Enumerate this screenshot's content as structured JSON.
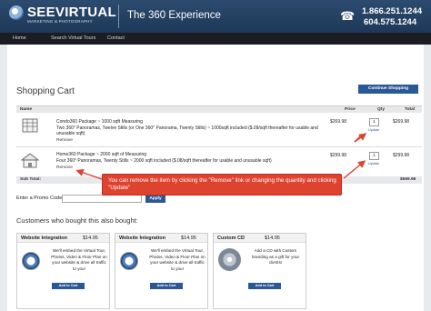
{
  "header": {
    "logo_text": "SEEVIRTUAL",
    "logo_sub": "MARKETING & PHOTOGRAPHY",
    "tagline": "The 360 Experience",
    "phone1": "1.866.251.1244",
    "phone2": "604.575.1244",
    "icons": [
      "globe-logo-icon",
      "phone-icon"
    ]
  },
  "nav": {
    "items": [
      "Home",
      "Search Virtual Tours",
      "Contact"
    ]
  },
  "cart": {
    "title": "Shopping Cart",
    "continue_label": "Continue Shopping",
    "columns": {
      "name": "Name",
      "price": "Price",
      "qty": "Qty",
      "total": "Total"
    },
    "items": [
      {
        "title": "Condo360 Package ~ 1000 sqft Measuring",
        "description": "Two 360° Panoramas, Twelve Stills (or One 360° Panorama, Twenty Stills) ~ 1000sqft included ($.09/sqft thereafter for usable and unusable sqft)",
        "remove": "Remove",
        "price": "$269.98",
        "qty": "1",
        "update": "Update",
        "total": "$269.98",
        "icon": "condo-building-icon"
      },
      {
        "title": "Home360 Package ~ 2000 sqft of Measuring",
        "description": "Four 360° Panoramas, Twenty Stills ~ 2000 sqft included ($.08/sqft thereafter for usable and unusable sqft)",
        "remove": "Remove",
        "price": "$299.98",
        "qty": "1",
        "update": "Update",
        "total": "$299.98",
        "icon": "house-icon"
      }
    ],
    "subtotal_label": "Sub Total:",
    "subtotal": "$569.96",
    "promo_label": "Enter a Promo Code:",
    "promo_value": "",
    "apply_label": "Apply"
  },
  "annotation": {
    "text": "You can remove the item by clicking the \"Remove\" link or changing the quantity and clicking \"Update\"",
    "color": "#de4330"
  },
  "also_bought": {
    "title": "Customers who bought this also bought:",
    "products": [
      {
        "name": "Website Integration",
        "price": "$14.95",
        "description": "We'll embed the Virtual Tour, Photos, Video & Floor Plan on your website & drive all traffic to you!",
        "button": "Add to Cart",
        "icon": "integration-badge-icon"
      },
      {
        "name": "Website Integration",
        "price": "$14.95",
        "description": "We'll embed the Virtual Tour, Photos, Video & Floor Plan on your website & drive all traffic to you!",
        "button": "Add to Cart",
        "icon": "integration-badge-icon"
      },
      {
        "name": "Custom CD",
        "price": "$14.95",
        "description": "Add a CD with Custom branding as a gift for your clients!",
        "button": "Add to Cart",
        "icon": "cd-disc-icon"
      }
    ]
  },
  "colors": {
    "header": "#2c4b6e",
    "nav": "#1b1d22",
    "button": "#2a5896",
    "annotation": "#de4330"
  }
}
